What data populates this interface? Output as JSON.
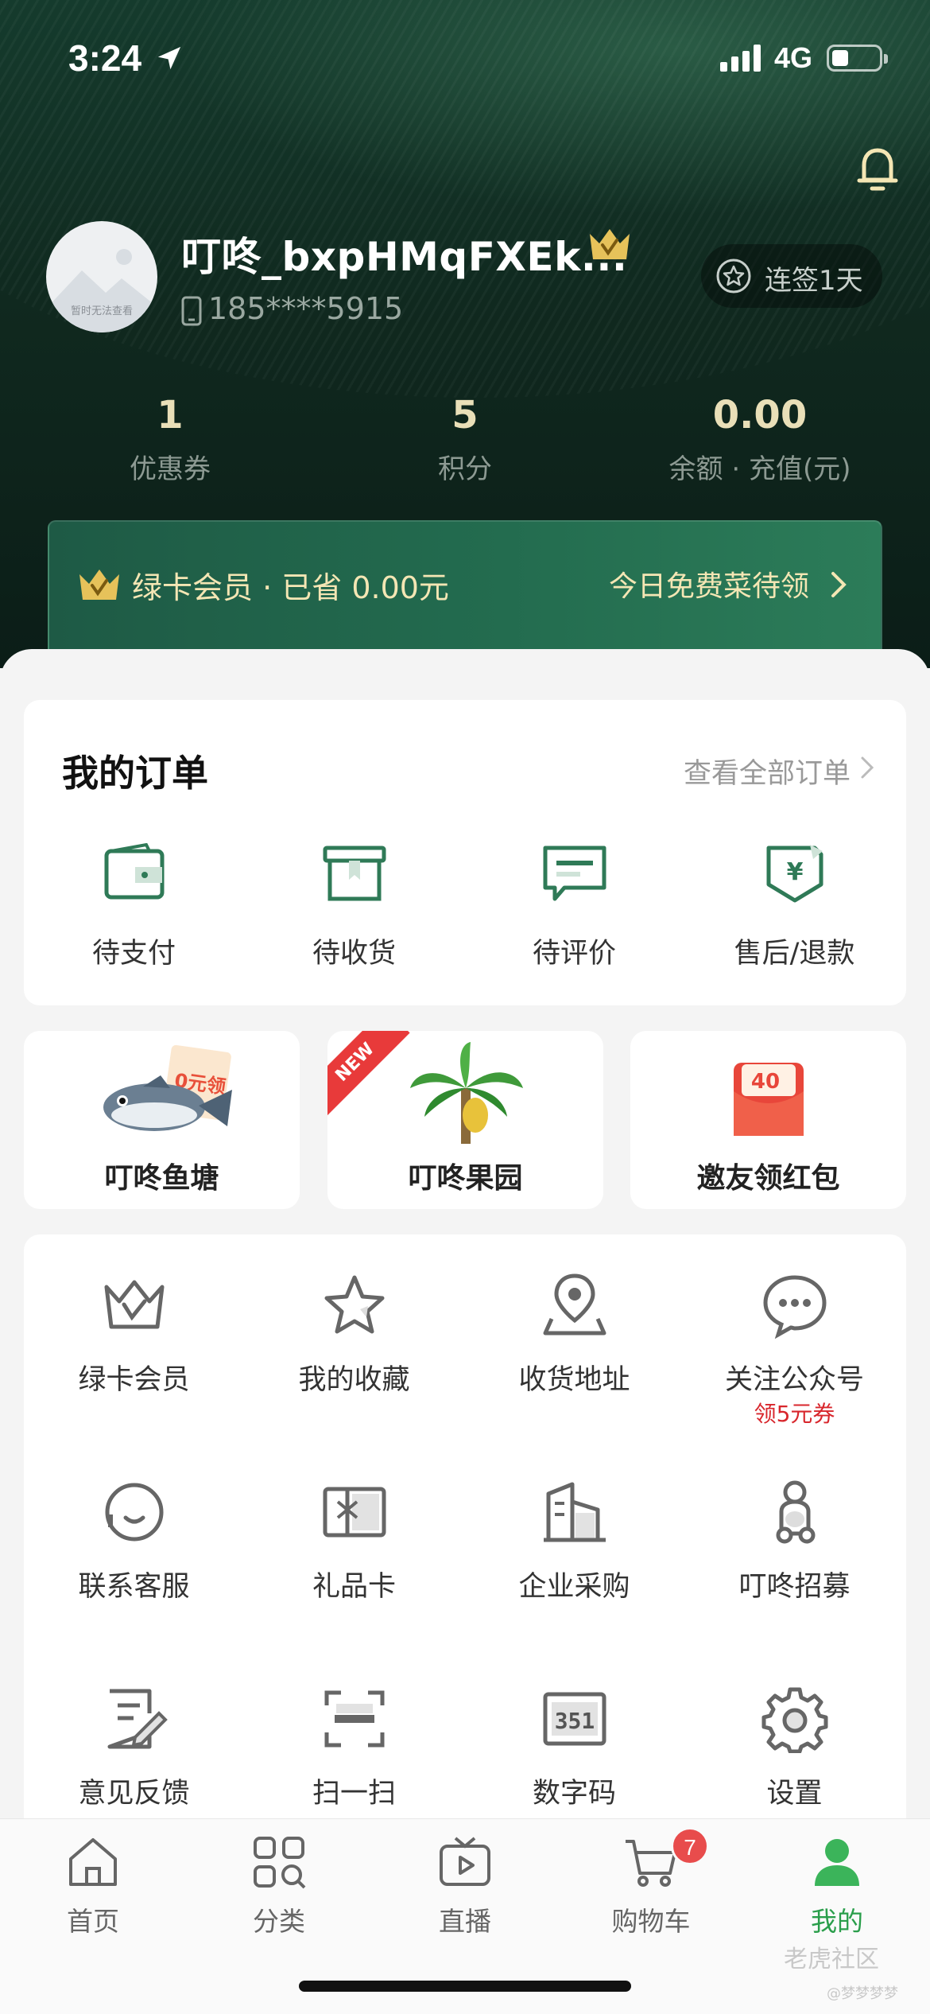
{
  "status_bar": {
    "time": "3:24",
    "network": "4G"
  },
  "profile": {
    "avatar_caption": "暂时无法查看",
    "username": "叮咚_bxpHMqFXEk...",
    "phone": "185****5915",
    "checkin_label": "连签1天"
  },
  "stats": [
    {
      "value": "1",
      "label": "优惠券"
    },
    {
      "value": "5",
      "label": "积分"
    },
    {
      "value": "0.00",
      "label": "余额 · 充值(元)"
    }
  ],
  "member_bar": {
    "left_text": "绿卡会员 · 已省 0.00元",
    "right_text": "今日免费菜待领"
  },
  "orders": {
    "title": "我的订单",
    "view_all": "查看全部订单",
    "items": [
      {
        "label": "待支付",
        "icon": "wallet-icon"
      },
      {
        "label": "待收货",
        "icon": "box-icon"
      },
      {
        "label": "待评价",
        "icon": "comment-icon"
      },
      {
        "label": "售后/退款",
        "icon": "refund-icon"
      }
    ]
  },
  "promos": [
    {
      "label": "叮咚鱼塘",
      "art_text": "0元领"
    },
    {
      "label": "叮咚果园",
      "tag": "NEW"
    },
    {
      "label": "邀友领红包",
      "art_text": "40"
    }
  ],
  "services": [
    {
      "label": "绿卡会员",
      "icon": "crown-icon"
    },
    {
      "label": "我的收藏",
      "icon": "star-icon"
    },
    {
      "label": "收货地址",
      "icon": "location-icon"
    },
    {
      "label": "关注公众号",
      "icon": "wechat-bubble-icon",
      "sub": "领5元券"
    },
    {
      "label": "联系客服",
      "icon": "customer-service-icon"
    },
    {
      "label": "礼品卡",
      "icon": "gift-card-icon"
    },
    {
      "label": "企业采购",
      "icon": "building-icon"
    },
    {
      "label": "叮咚招募",
      "icon": "courier-icon"
    },
    {
      "label": "意见反馈",
      "icon": "feedback-icon"
    },
    {
      "label": "扫一扫",
      "icon": "scan-icon"
    },
    {
      "label": "数字码",
      "icon": "digit-code-icon",
      "art_text": "351"
    },
    {
      "label": "设置",
      "icon": "gear-icon"
    }
  ],
  "tabs": [
    {
      "label": "首页",
      "icon": "home-icon"
    },
    {
      "label": "分类",
      "icon": "category-icon"
    },
    {
      "label": "直播",
      "icon": "live-tv-icon"
    },
    {
      "label": "购物车",
      "icon": "cart-icon",
      "badge": "7"
    },
    {
      "label": "我的",
      "icon": "profile-icon",
      "active": true
    }
  ],
  "watermark": {
    "main": "老虎社区",
    "sub": "@梦梦梦梦"
  },
  "colors": {
    "header_dark": "#10291f",
    "gold": "#f4e6b4",
    "brand_green": "#2a9e4b",
    "order_icon_green": "#2f7a57",
    "badge_red": "#e84c4c"
  }
}
